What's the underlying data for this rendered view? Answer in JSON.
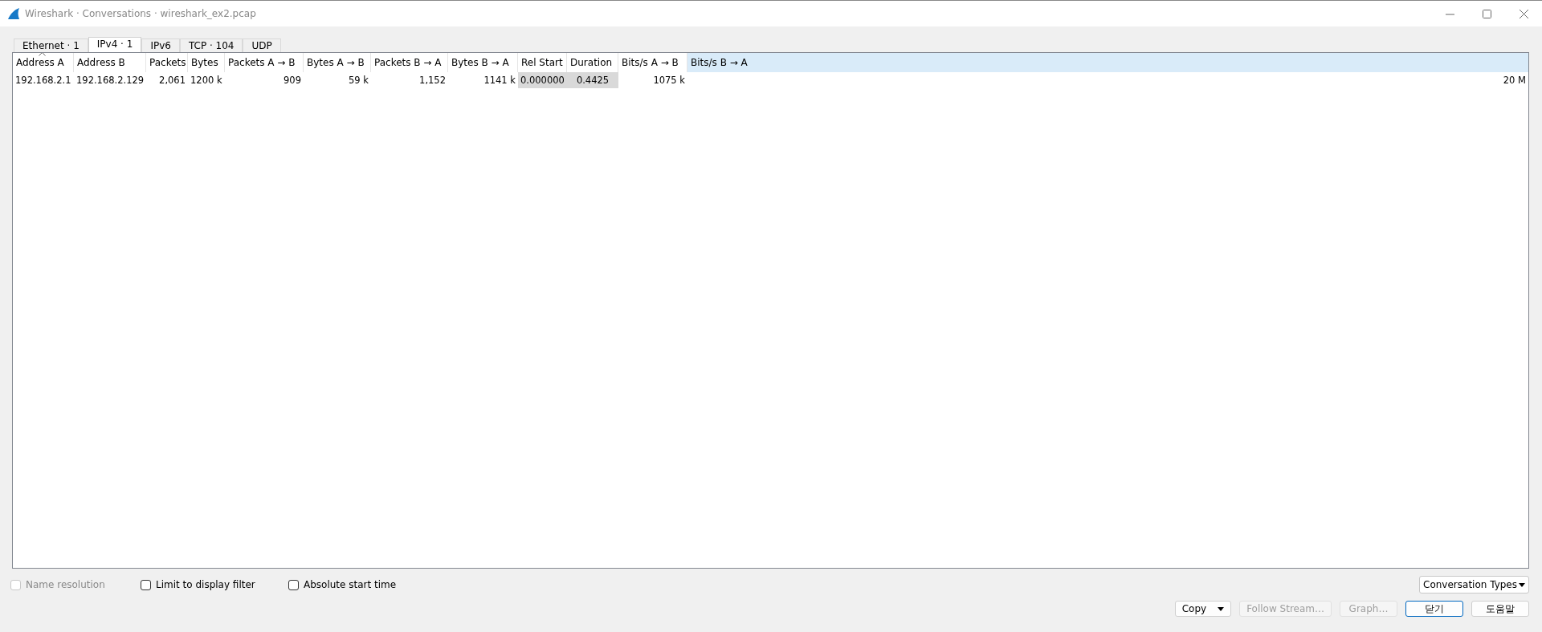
{
  "window": {
    "title": "Wireshark · Conversations · wireshark_ex2.pcap"
  },
  "tabs": [
    {
      "label": "Ethernet · 1",
      "selected": false
    },
    {
      "label": "IPv4 · 1",
      "selected": true
    },
    {
      "label": "IPv6",
      "selected": false
    },
    {
      "label": "TCP · 104",
      "selected": false
    },
    {
      "label": "UDP",
      "selected": false
    }
  ],
  "table": {
    "columns": [
      {
        "label": "Address A",
        "sorted": true,
        "hovered": false,
        "shaded": false
      },
      {
        "label": "Address B",
        "sorted": false,
        "hovered": false,
        "shaded": false
      },
      {
        "label": "Packets",
        "sorted": false,
        "hovered": false,
        "shaded": false
      },
      {
        "label": "Bytes",
        "sorted": false,
        "hovered": false,
        "shaded": false
      },
      {
        "label": "Packets A → B",
        "sorted": false,
        "hovered": false,
        "shaded": false
      },
      {
        "label": "Bytes A → B",
        "sorted": false,
        "hovered": false,
        "shaded": false
      },
      {
        "label": "Packets B → A",
        "sorted": false,
        "hovered": false,
        "shaded": false
      },
      {
        "label": "Bytes B → A",
        "sorted": false,
        "hovered": false,
        "shaded": false
      },
      {
        "label": "Rel Start",
        "sorted": false,
        "hovered": false,
        "shaded": true
      },
      {
        "label": "Duration",
        "sorted": false,
        "hovered": false,
        "shaded": true
      },
      {
        "label": "Bits/s A → B",
        "sorted": false,
        "hovered": false,
        "shaded": false
      },
      {
        "label": "Bits/s B → A",
        "sorted": false,
        "hovered": true,
        "shaded": false
      }
    ],
    "rows": [
      [
        "192.168.2.1",
        "192.168.2.129",
        "2,061",
        "1200 k",
        "909",
        "59 k",
        "1,152",
        "1141 k",
        "0.000000",
        "0.4425",
        "1075 k",
        "20 M"
      ]
    ]
  },
  "options": [
    {
      "label": "Name resolution",
      "checked": false,
      "disabled": true
    },
    {
      "label": "Limit to display filter",
      "checked": false,
      "disabled": false
    },
    {
      "label": "Absolute start time",
      "checked": false,
      "disabled": false
    }
  ],
  "conversation_types": {
    "label": "Conversation Types"
  },
  "buttons": [
    {
      "label": "Copy",
      "kind": "menu",
      "disabled": false,
      "default": false
    },
    {
      "label": "Follow Stream…",
      "kind": "plain",
      "disabled": true,
      "default": false
    },
    {
      "label": "Graph…",
      "kind": "plain",
      "disabled": true,
      "default": false
    },
    {
      "label": "닫기",
      "kind": "plain",
      "disabled": false,
      "default": true
    },
    {
      "label": "도움말",
      "kind": "plain",
      "disabled": false,
      "default": false
    }
  ]
}
